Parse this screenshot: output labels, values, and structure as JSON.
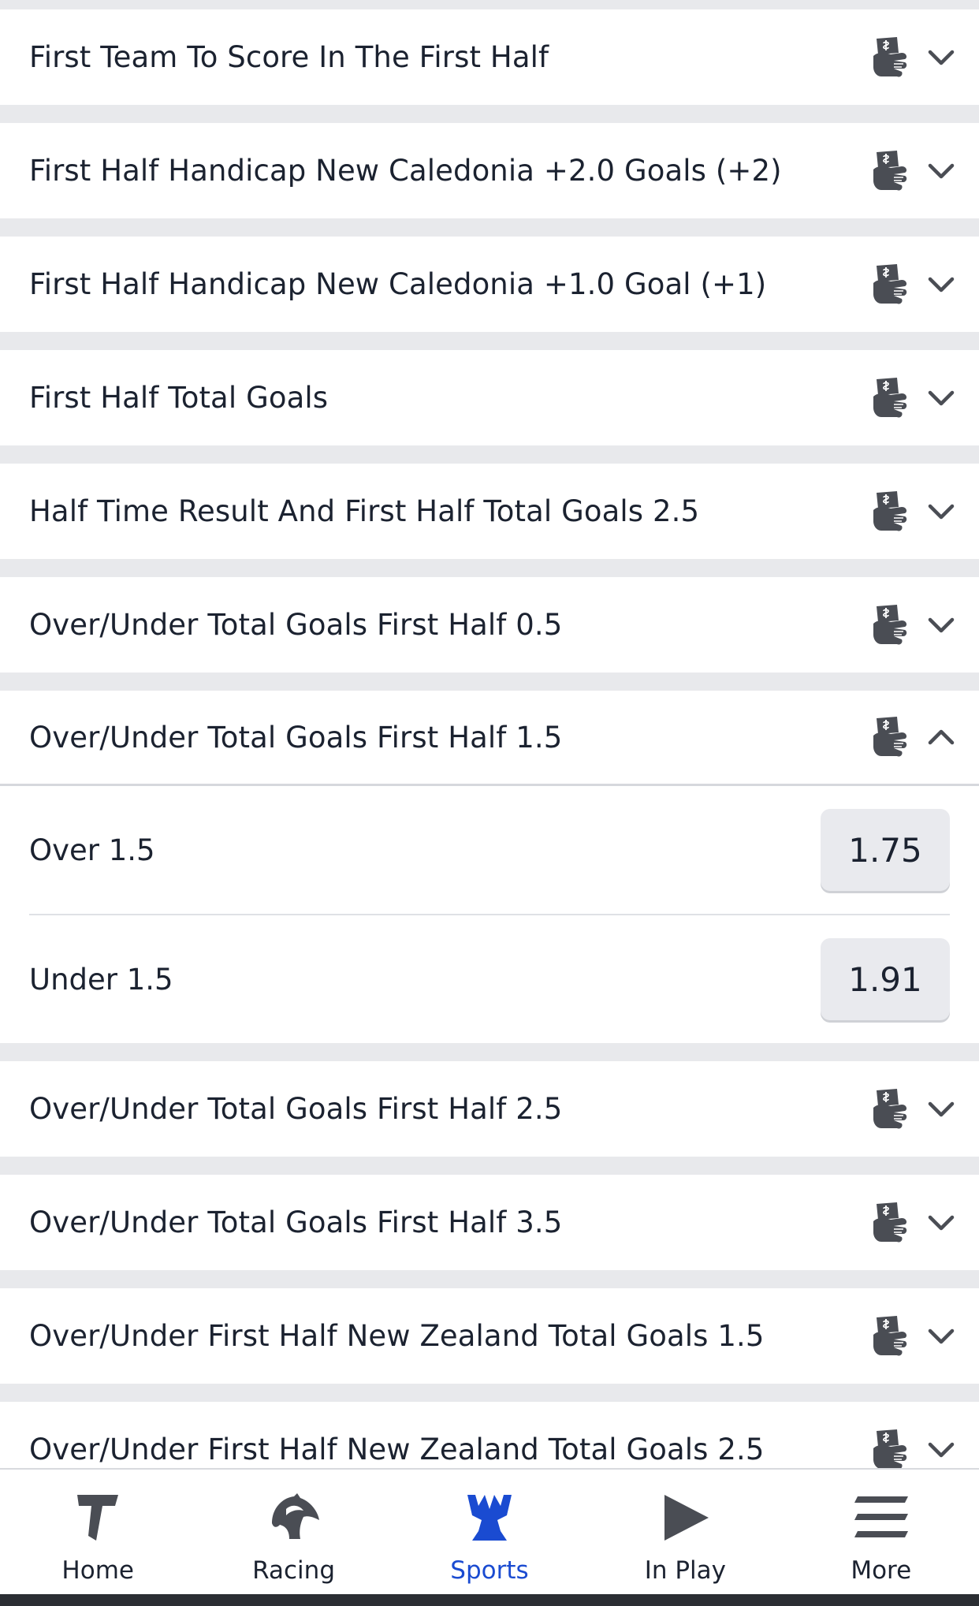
{
  "markets": [
    {
      "title": "First Team To Score In The First Half",
      "expanded": false
    },
    {
      "title": "First Half Handicap New Caledonia +2.0 Goals (+2)",
      "expanded": false
    },
    {
      "title": "First Half Handicap New Caledonia +1.0 Goal (+1)",
      "expanded": false
    },
    {
      "title": "First Half Total Goals",
      "expanded": false
    },
    {
      "title": "Half Time Result And First Half Total Goals 2.5",
      "expanded": false
    },
    {
      "title": "Over/Under Total Goals First Half 0.5",
      "expanded": false
    },
    {
      "title": "Over/Under Total Goals First Half 1.5",
      "expanded": true,
      "selections": [
        {
          "label": "Over 1.5",
          "odds": "1.75"
        },
        {
          "label": "Under 1.5",
          "odds": "1.91"
        }
      ]
    },
    {
      "title": "Over/Under Total Goals First Half 2.5",
      "expanded": false
    },
    {
      "title": "Over/Under Total Goals First Half 3.5",
      "expanded": false
    },
    {
      "title": "Over/Under First Half New Zealand Total Goals 1.5",
      "expanded": false
    },
    {
      "title": "Over/Under First Half New Zealand Total Goals 2.5",
      "expanded": false
    }
  ],
  "nav": {
    "home": "Home",
    "racing": "Racing",
    "sports": "Sports",
    "in_play": "In Play",
    "more": "More",
    "active": "sports"
  },
  "colors": {
    "accent": "#1a4bd1",
    "text": "#1b2230",
    "icon": "#4a4d54",
    "background": "#e8e9ec"
  },
  "icons": {
    "market_feature": "same-game-multi-icon",
    "collapsed": "chevron-down-icon",
    "expanded": "chevron-up-icon"
  }
}
